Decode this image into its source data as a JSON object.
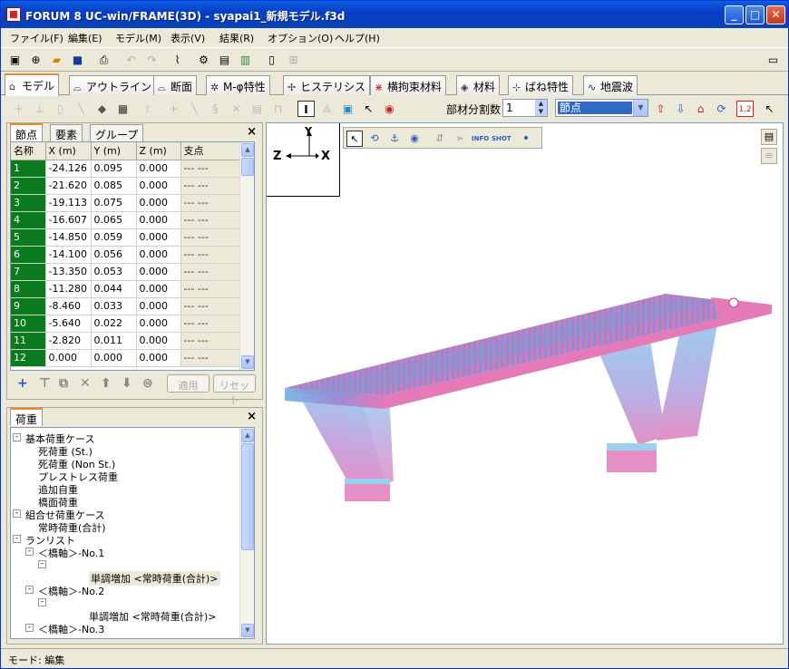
{
  "window": {
    "title": "FORUM 8   UC-win/FRAME(3D) - syapai1_新規モデル.f3d"
  },
  "menu": [
    {
      "label": "ファイル(F)",
      "name": "menu-file"
    },
    {
      "label": "編集(E)",
      "name": "menu-edit"
    },
    {
      "label": "モデル(M)",
      "name": "menu-model"
    },
    {
      "label": "表示(V)",
      "name": "menu-view"
    },
    {
      "label": "結果(R)",
      "name": "menu-result"
    },
    {
      "label": "オプション(O)",
      "name": "menu-option"
    },
    {
      "label": "ヘルプ(H)",
      "name": "menu-help"
    }
  ],
  "tabs": [
    {
      "label": "モデル",
      "icon": "model-icon",
      "active": true
    },
    {
      "label": "アウトライン",
      "icon": "outline-icon"
    },
    {
      "label": "断面",
      "icon": "section-icon"
    },
    {
      "label": "M-φ特性",
      "icon": "m-phi-icon"
    },
    {
      "label": "ヒステリシス",
      "icon": "hysteresis-icon"
    },
    {
      "label": "横拘束材料",
      "icon": "lateral-restraint-icon"
    },
    {
      "label": "材料",
      "icon": "material-icon"
    },
    {
      "label": "ばね特性",
      "icon": "spring-icon"
    },
    {
      "label": "地震波",
      "icon": "seismic-wave-icon"
    }
  ],
  "toolbar2": {
    "divisions_label": "部材分割数",
    "divisions_value": "1",
    "mode_select": "節点",
    "zoom_label": "1.2"
  },
  "node_panel": {
    "tabs": [
      "節点",
      "要素",
      "グループ"
    ],
    "columns": [
      "名称",
      "X (m)",
      "Y (m)",
      "Z (m)",
      "支点"
    ],
    "rows": [
      [
        "1",
        "-24.126",
        "0.095",
        "0.000",
        "--- ---"
      ],
      [
        "2",
        "-21.620",
        "0.085",
        "0.000",
        "--- ---"
      ],
      [
        "3",
        "-19.113",
        "0.075",
        "0.000",
        "--- ---"
      ],
      [
        "4",
        "-16.607",
        "0.065",
        "0.000",
        "--- ---"
      ],
      [
        "5",
        "-14.850",
        "0.059",
        "0.000",
        "--- ---"
      ],
      [
        "6",
        "-14.100",
        "0.056",
        "0.000",
        "--- ---"
      ],
      [
        "7",
        "-13.350",
        "0.053",
        "0.000",
        "--- ---"
      ],
      [
        "8",
        "-11.280",
        "0.044",
        "0.000",
        "--- ---"
      ],
      [
        "9",
        "-8.460",
        "0.033",
        "0.000",
        "--- ---"
      ],
      [
        "10",
        "-5.640",
        "0.022",
        "0.000",
        "--- ---"
      ],
      [
        "11",
        "-2.820",
        "0.011",
        "0.000",
        "--- ---"
      ],
      [
        "12",
        "0.000",
        "0.000",
        "0.000",
        "--- ---"
      ]
    ],
    "apply_label": "適用",
    "reset_label": "リセット"
  },
  "load_panel": {
    "tab": "荷重",
    "tree": [
      {
        "label": "基本荷重ケース",
        "level": 0,
        "pm": "-"
      },
      {
        "label": "死荷重 (St.)",
        "level": 1
      },
      {
        "label": "死荷重 (Non St.)",
        "level": 1
      },
      {
        "label": "プレストレス荷重",
        "level": 1
      },
      {
        "label": "追加自重",
        "level": 1
      },
      {
        "label": "橋面荷重",
        "level": 1
      },
      {
        "label": "組合せ荷重ケース",
        "level": 0,
        "pm": "-"
      },
      {
        "label": "常時荷重(合計)",
        "level": 1
      },
      {
        "label": "ランリスト",
        "level": 0,
        "pm": "-"
      },
      {
        "label": "＜橋軸＞-No.1",
        "level": 1,
        "pm": "-"
      },
      {
        "label": "",
        "level": 2,
        "pm": "-"
      },
      {
        "label": "単調増加 <常時荷重(合計)>",
        "level": 3,
        "highlight": true
      },
      {
        "label": "＜橋軸＞-No.2",
        "level": 1,
        "pm": "-"
      },
      {
        "label": "",
        "level": 2,
        "pm": "-"
      },
      {
        "label": "単調増加 <常時荷重(合計)>",
        "level": 3
      },
      {
        "label": "＜橋軸＞-No.3",
        "level": 1,
        "pm": "-"
      }
    ]
  },
  "viewport": {
    "axis_y": "Y",
    "axis_z": "Z",
    "axis_x": "X",
    "tools": [
      "select-arrow-icon",
      "rotate-icon",
      "pan-icon",
      "eye-icon",
      "move-icon",
      "arrow-icon",
      "info-icon",
      "shot-icon",
      "dot-icon"
    ],
    "info_label": "INFO",
    "shot_label": "SHOT",
    "colors": {
      "deck_top": "#e57ab8",
      "deck_side": "#7bbbe6",
      "pier_top": "#9ad0f0",
      "pier_bottom": "#e58fc4"
    }
  },
  "status": {
    "text": "モード: 編集"
  }
}
